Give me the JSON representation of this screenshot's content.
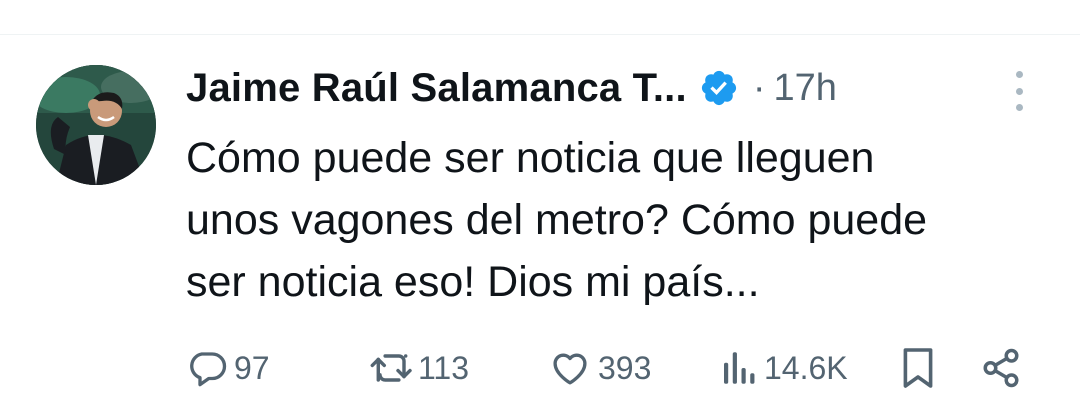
{
  "tweet": {
    "author": {
      "display_name": "Jaime Raúl Salamanca T...",
      "verified": true
    },
    "time_ago": "17h",
    "separator": "·",
    "text": "Cómo puede ser noticia que lleguen\nunos vagones del metro? Cómo puede\nser noticia eso! Dios mi país...",
    "actions": {
      "replies": "97",
      "retweets": "113",
      "likes": "393",
      "views": "14.6K"
    }
  },
  "icons": {
    "verified": "verified-badge-icon",
    "more": "more-vertical-icon",
    "reply": "reply-icon",
    "retweet": "retweet-icon",
    "like": "heart-icon",
    "views": "views-chart-icon",
    "bookmark": "bookmark-icon",
    "share": "share-icon"
  },
  "colors": {
    "verified_blue": "#1d9bf0",
    "secondary_text": "#536471",
    "primary_text": "#0f1419"
  }
}
